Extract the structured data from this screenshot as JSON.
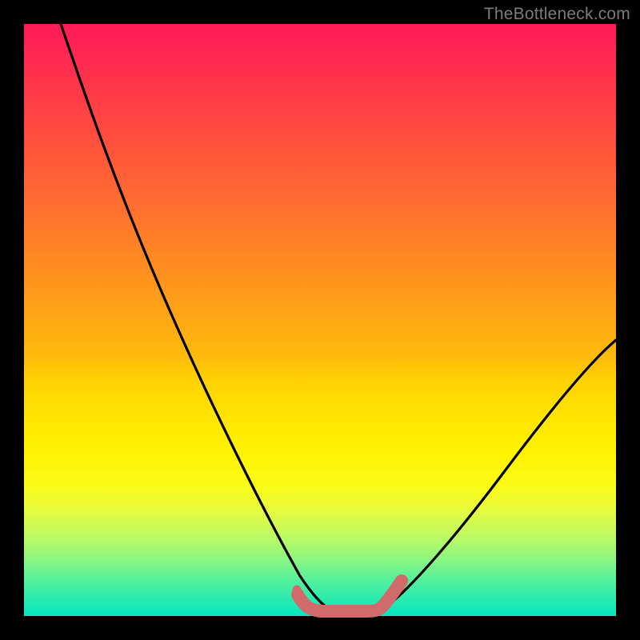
{
  "watermark": "TheBottleneck.com",
  "colors": {
    "frame": "#000000",
    "curve": "#000000",
    "accent": "#d16a6a"
  },
  "chart_data": {
    "type": "line",
    "title": "",
    "xlabel": "",
    "ylabel": "",
    "xlim": [
      0,
      100
    ],
    "ylim": [
      0,
      100
    ],
    "series": [
      {
        "name": "left-curve",
        "x": [
          0,
          6,
          12,
          18,
          24,
          30,
          36,
          42,
          46,
          49,
          51
        ],
        "y": [
          100,
          88,
          75,
          62,
          49,
          37,
          25,
          14,
          7,
          3,
          1
        ]
      },
      {
        "name": "right-curve",
        "x": [
          60,
          64,
          70,
          78,
          88,
          100
        ],
        "y": [
          2,
          6,
          13,
          22,
          33,
          46
        ]
      },
      {
        "name": "valley-accent",
        "x": [
          46,
          48,
          50,
          52,
          55,
          58,
          60,
          62
        ],
        "y": [
          3,
          2,
          1,
          1,
          1,
          1,
          2,
          5
        ]
      }
    ],
    "note": "Values in percent of plot box; y=0 at bottom, y=100 at top. Curves approximate a V-shaped bottleneck chart with an accented valley segment."
  }
}
